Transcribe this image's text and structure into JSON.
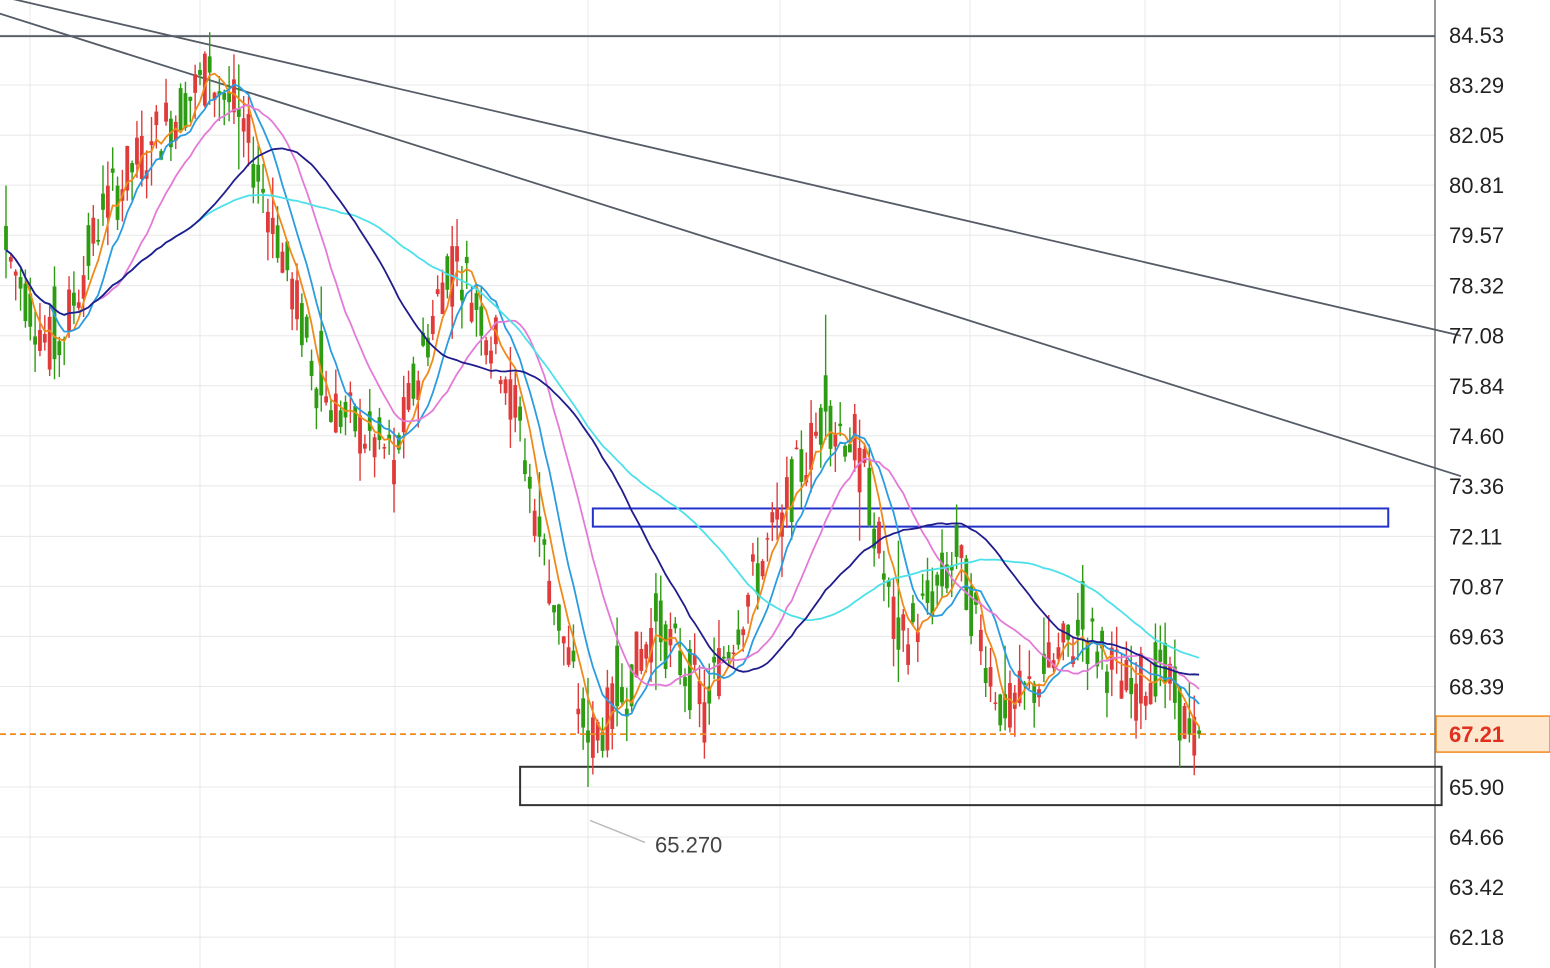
{
  "chart_data": {
    "type": "candlestick",
    "ylim": [
      61.6,
      85.0
    ],
    "y_ticks": [
      "84.53",
      "83.29",
      "82.05",
      "80.81",
      "79.57",
      "78.32",
      "77.08",
      "75.84",
      "74.60",
      "73.36",
      "72.11",
      "70.87",
      "69.63",
      "68.39",
      "65.90",
      "64.66",
      "63.42",
      "62.18"
    ],
    "current_price": {
      "label": "67.21",
      "value": 67.21
    },
    "low_annotation": {
      "label": "65.270",
      "value": 65.27
    },
    "horizontal_line": 84.5,
    "trendlines": [
      {
        "from": [
          -5,
          85.6
        ],
        "to": [
          300,
          77.08
        ]
      },
      {
        "from": [
          -5,
          85.2
        ],
        "to": [
          300,
          73.6
        ]
      }
    ],
    "zones": [
      {
        "name": "resistance-zone",
        "x": [
          121,
          285
        ],
        "y": [
          72.35,
          72.8
        ],
        "color": "#2233cc"
      },
      {
        "name": "support-zone",
        "x": [
          106,
          296
        ],
        "y": [
          65.45,
          66.4
        ],
        "color": "#333333"
      }
    ],
    "colors": {
      "up": "#e03b3b",
      "down": "#2e9c12",
      "grid": "#e8e8e8",
      "price_line": "#f08a1a"
    },
    "ohlc_anchors": [
      [
        0,
        79.8,
        80.8,
        78.5,
        79.2
      ],
      [
        10,
        78.3,
        78.8,
        76.0,
        76.5
      ],
      [
        20,
        80.6,
        81.3,
        79.8,
        80.2
      ],
      [
        30,
        81.8,
        82.5,
        80.8,
        81.9
      ],
      [
        42,
        84.0,
        84.6,
        82.8,
        83.6
      ],
      [
        48,
        82.7,
        83.8,
        81.2,
        82.5
      ],
      [
        55,
        79.6,
        81.0,
        79.0,
        80.0
      ],
      [
        65,
        77.2,
        78.3,
        75.2,
        75.6
      ],
      [
        80,
        73.4,
        74.8,
        72.7,
        74.0
      ],
      [
        92,
        77.8,
        79.8,
        77.0,
        79.3
      ],
      [
        104,
        75.0,
        76.8,
        74.3,
        76.0
      ],
      [
        110,
        72.6,
        73.7,
        71.6,
        72.1
      ],
      [
        120,
        67.3,
        68.6,
        65.9,
        67.0
      ],
      [
        126,
        69.4,
        70.1,
        67.4,
        67.9
      ],
      [
        134,
        70.7,
        71.2,
        68.3,
        70.0
      ],
      [
        144,
        67.0,
        68.8,
        66.6,
        68.0
      ],
      [
        160,
        72.1,
        72.9,
        71.1,
        72.7
      ],
      [
        169,
        76.1,
        77.6,
        74.5,
        75.2
      ],
      [
        176,
        73.2,
        75.0,
        72.0,
        74.3
      ],
      [
        184,
        70.1,
        72.0,
        68.5,
        69.3
      ],
      [
        196,
        72.4,
        72.9,
        71.3,
        71.6
      ],
      [
        206,
        68.2,
        69.4,
        67.3,
        67.6
      ],
      [
        214,
        69.2,
        70.1,
        68.5,
        68.7
      ],
      [
        222,
        71.0,
        71.4,
        69.0,
        69.8
      ],
      [
        232,
        68.6,
        69.4,
        67.6,
        68.2
      ],
      [
        238,
        69.3,
        69.9,
        68.4,
        69.0
      ],
      [
        244,
        67.6,
        68.5,
        67.0,
        67.2
      ],
      [
        246,
        67.3,
        67.4,
        67.1,
        67.21
      ]
    ],
    "moving_averages": [
      {
        "name": "ma-orange",
        "color": "#f08a1a",
        "period": 5
      },
      {
        "name": "ma-blue",
        "color": "#2a9ce0",
        "period": 10
      },
      {
        "name": "ma-pink",
        "color": "#e47ad7",
        "period": 20
      },
      {
        "name": "ma-cyan",
        "color": "#4ee0ea",
        "period": 60,
        "start": 0,
        "end": 246
      },
      {
        "name": "ma-navy",
        "color": "#201c8c",
        "period": 40
      }
    ]
  }
}
